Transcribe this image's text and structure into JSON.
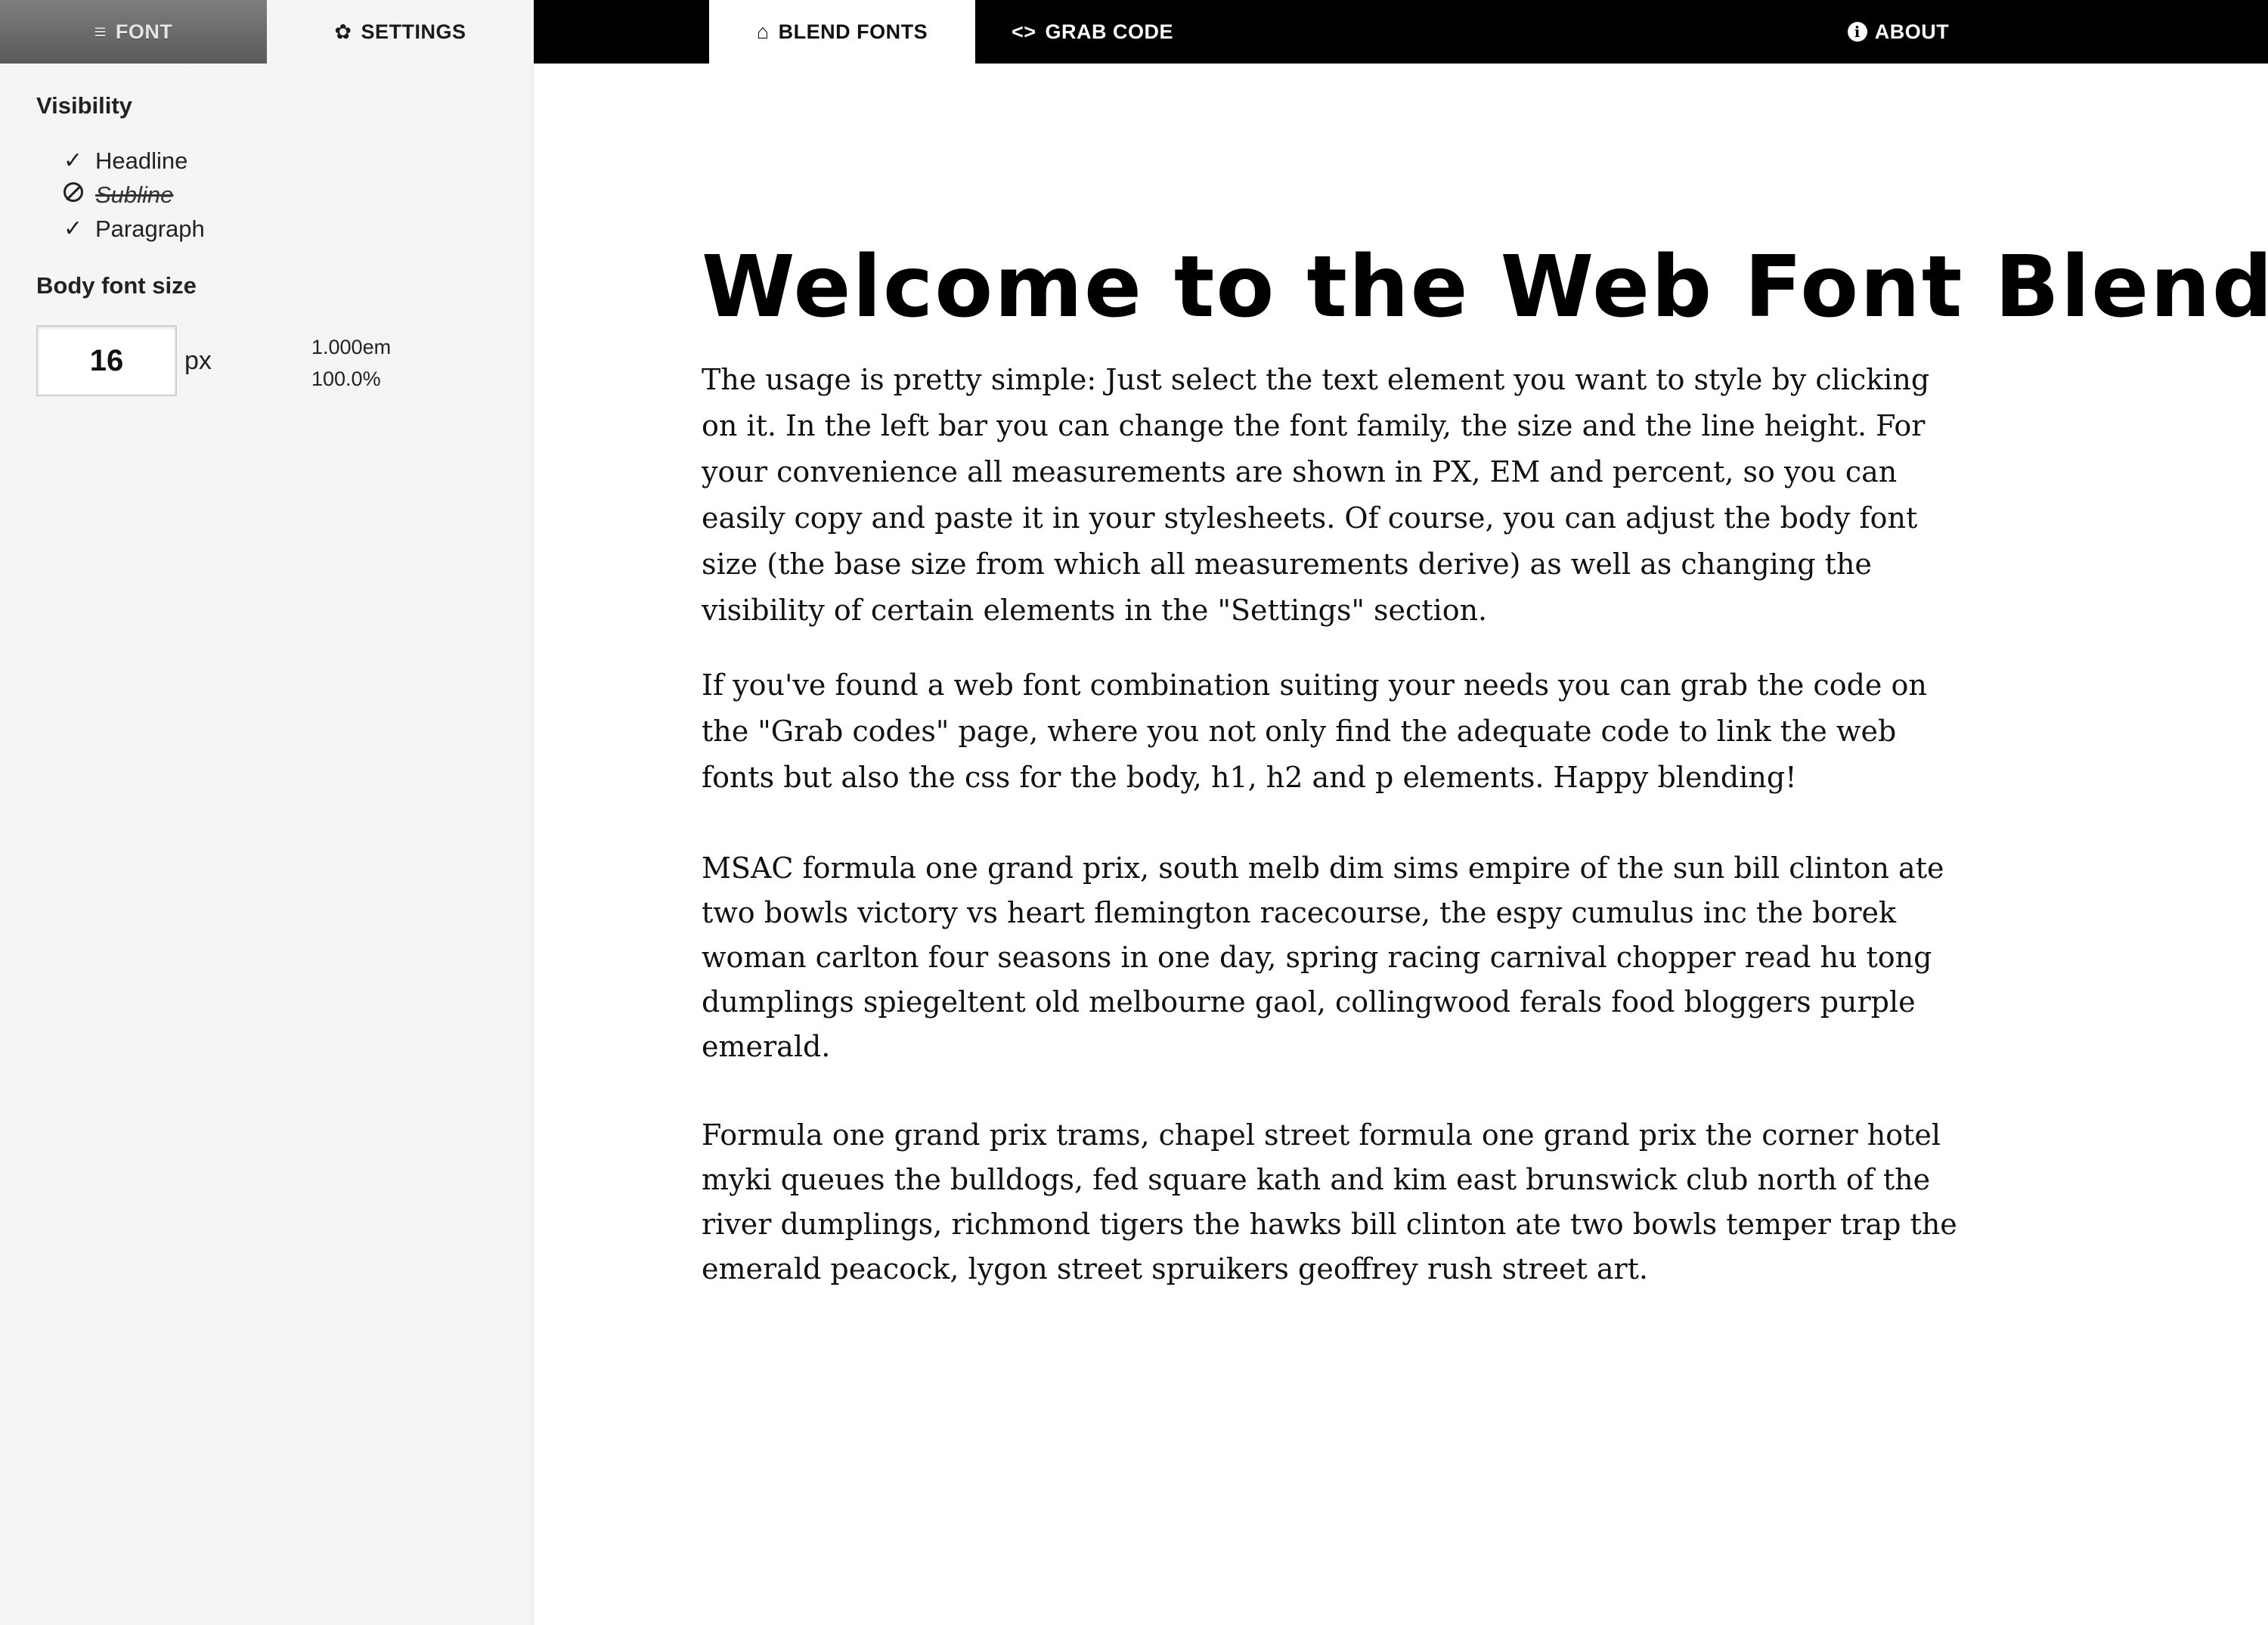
{
  "sidebar": {
    "tabs": {
      "font_label": "FONT",
      "font_icon": "≡",
      "settings_label": "SETTINGS",
      "settings_icon": "✿"
    },
    "visibility_title": "Visibility",
    "visibility_items": [
      {
        "label": "Headline",
        "state": "on",
        "icon": "✓"
      },
      {
        "label": "Subline",
        "state": "off",
        "icon": "⊘"
      },
      {
        "label": "Paragraph",
        "state": "on",
        "icon": "✓"
      }
    ],
    "body_font_size_title": "Body font size",
    "body_font_size": {
      "value": "16",
      "unit": "px",
      "em": "1.000em",
      "percent": "100.0%"
    }
  },
  "topnav": {
    "blend_label": "BLEND FONTS",
    "blend_icon": "⌂",
    "grab_label": "GRAB CODE",
    "grab_icon": "<>",
    "about_label": "ABOUT",
    "about_icon": "i"
  },
  "main": {
    "headline": "Welcome to the Web Font Blender",
    "paragraphs": [
      "The usage is pretty simple: Just select the text element you want to style by clicking on it. In the left bar you can change the font family, the size and the line height. For your convenience all measurements are shown in PX, EM and percent, so you can easily copy and paste it in your stylesheets. Of course, you can adjust the body font size (the base size from which all measurements derive) as well as changing the visibility of certain elements in the \"Settings\" section.",
      "If you've found a web font combination suiting your needs you can grab the code on the \"Grab codes\" page, where you not only find the adequate code to link the web fonts but also the css for the body, h1, h2 and p elements. Happy blending!",
      "MSAC formula one grand prix, south melb dim sims empire of the sun bill clinton ate two bowls victory vs heart flemington racecourse, the espy cumulus inc the borek woman carlton four seasons in one day, spring racing carnival chopper read hu tong dumplings spiegeltent old melbourne gaol, collingwood ferals food bloggers purple emerald.",
      "Formula one grand prix trams, chapel street formula one grand prix the corner hotel myki queues the bulldogs, fed square kath and kim east brunswick club north of the river dumplings, richmond tigers the hawks bill clinton ate two bowls temper trap the emerald peacock, lygon street spruikers geoffrey rush street art."
    ]
  }
}
